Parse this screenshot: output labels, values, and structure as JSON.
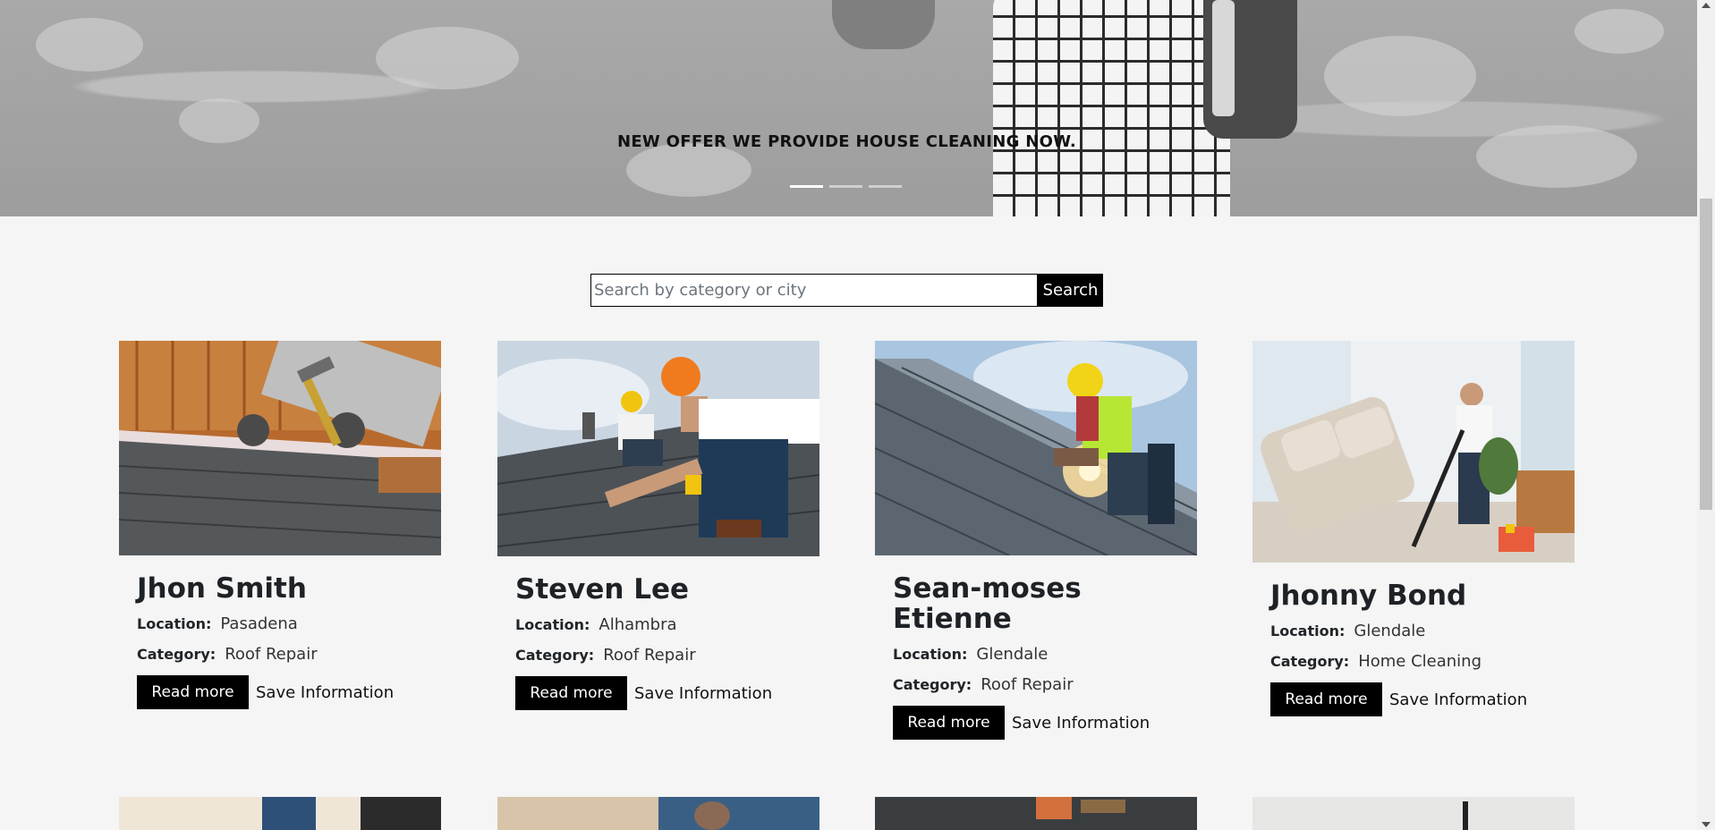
{
  "hero": {
    "caption": "NEW OFFER WE PROVIDE HOUSE CLEANING NOW.",
    "slides_count": 3,
    "active_slide": 1
  },
  "search": {
    "placeholder": "Search by category or city",
    "value": "",
    "button_label": "Search"
  },
  "cards": [
    {
      "name": "Jhon Smith",
      "location_label": "Location:",
      "location": "Pasadena",
      "category_label": "Category:",
      "category": "Roof Repair",
      "read_more": "Read more",
      "save": "Save Information"
    },
    {
      "name": "Steven Lee",
      "location_label": "Location:",
      "location": "Alhambra",
      "category_label": "Category:",
      "category": "Roof Repair",
      "read_more": "Read more",
      "save": "Save Information"
    },
    {
      "name": "Sean-moses Etienne",
      "location_label": "Location:",
      "location": "Glendale",
      "category_label": "Category:",
      "category": "Roof Repair",
      "read_more": "Read more",
      "save": "Save Information"
    },
    {
      "name": "Jhonny Bond",
      "location_label": "Location:",
      "location": "Glendale",
      "category_label": "Category:",
      "category": "Home Cleaning",
      "read_more": "Read more",
      "save": "Save Information"
    }
  ],
  "colors": {
    "button_bg": "#000000",
    "page_bg": "#f4f5f4"
  }
}
